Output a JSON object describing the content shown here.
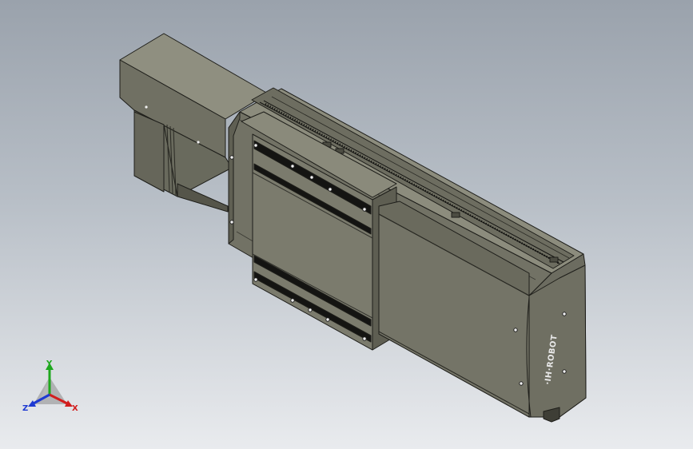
{
  "viewport": {
    "background_top": "#9aa2ac",
    "background_bottom": "#e9ebee"
  },
  "model": {
    "body_color": "#77776a",
    "edge_color": "#1e1e1a",
    "logo_text": "·IH·ROBOT"
  },
  "triad": {
    "x_label": "X",
    "y_label": "Y",
    "z_label": "Z",
    "x_color": "#d21e1e",
    "y_color": "#1ea81e",
    "z_color": "#1e3ad2"
  }
}
